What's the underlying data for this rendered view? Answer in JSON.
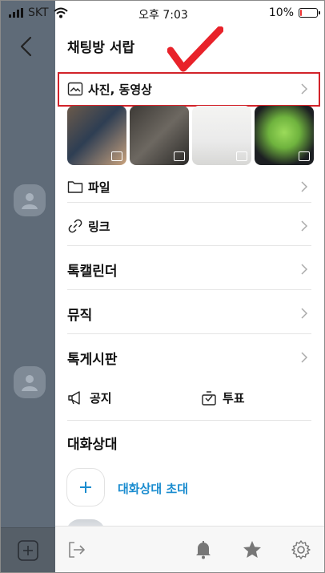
{
  "status_bar": {
    "carrier": "SKT",
    "time": "오후 7:03",
    "battery": "10%",
    "battery_level": 0.1
  },
  "drawer": {
    "title": "채팅방 서랍",
    "photos_label": "사진, 동영상",
    "items": [
      {
        "label": "파일",
        "icon": "folder-icon"
      },
      {
        "label": "링크",
        "icon": "link-icon"
      },
      {
        "label": "톡캘린더"
      },
      {
        "label": "뮤직"
      },
      {
        "label": "톡게시판"
      }
    ],
    "notice_label": "공지",
    "vote_label": "투표",
    "members_title": "대화상대",
    "invite_label": "대화상대 초대"
  },
  "colors": {
    "highlight": "#d2232a",
    "checkmark": "#e8222a",
    "invite_text": "#1a8ccf",
    "dim_overlay": "#5f6b78"
  },
  "bottom_bar": {
    "icons": [
      "exit-icon",
      "bell-icon",
      "star-icon",
      "gear-icon"
    ]
  }
}
